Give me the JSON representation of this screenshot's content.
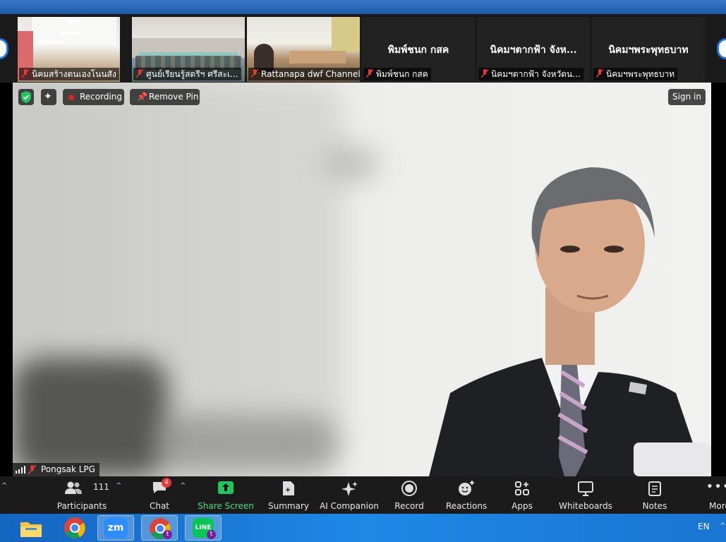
{
  "gallery": {
    "tiles": [
      {
        "name": "นิคมสร้างตนเองโนนสัง",
        "kind": "video"
      },
      {
        "name": "ศูนย์เรียนรู้สตรีฯ ศรีสะเ...",
        "kind": "video"
      },
      {
        "name": "Rattanapa dwf Channel",
        "kind": "video"
      },
      {
        "name": "พิมพ์ชนก กสค",
        "display": "พิมพ์ชนก กสค",
        "kind": "name"
      },
      {
        "name": "นิคมฯตากฟ้า จังหวัดน...",
        "display": "นิคมฯตากฟ้า จังห...",
        "kind": "name"
      },
      {
        "name": "นิคมฯพระพุทธบาท",
        "display": "นิคมฯพระพุทธบาท",
        "kind": "name"
      }
    ]
  },
  "meeting": {
    "recording_label": "Recording",
    "remove_pin_label": "Remove Pin",
    "sign_in_label": "Sign in",
    "speaker_name": "Pongsak LPG"
  },
  "toolbar": {
    "participants_count": "111",
    "chat_badge": "4",
    "items": [
      {
        "label": "Participants",
        "icon": "participants-icon"
      },
      {
        "label": "Chat",
        "icon": "chat-icon"
      },
      {
        "label": "Share Screen",
        "icon": "share-screen-icon"
      },
      {
        "label": "Summary",
        "icon": "summary-icon"
      },
      {
        "label": "AI Companion",
        "icon": "ai-companion-icon"
      },
      {
        "label": "Record",
        "icon": "record-icon"
      },
      {
        "label": "Reactions",
        "icon": "reactions-icon"
      },
      {
        "label": "Apps",
        "icon": "apps-icon"
      },
      {
        "label": "Whiteboards",
        "icon": "whiteboards-icon"
      },
      {
        "label": "Notes",
        "icon": "notes-icon"
      },
      {
        "label": "More",
        "icon": "more-icon"
      }
    ]
  },
  "taskbar": {
    "zoom_text": "zm",
    "line_text": "LINE",
    "chrome_badge": "t",
    "line_badge": "t",
    "language": "EN"
  },
  "colors": {
    "share_green": "#22c55e",
    "record_red": "#e02424",
    "badge_red": "#e53935",
    "accent_blue": "#1a73e8"
  }
}
